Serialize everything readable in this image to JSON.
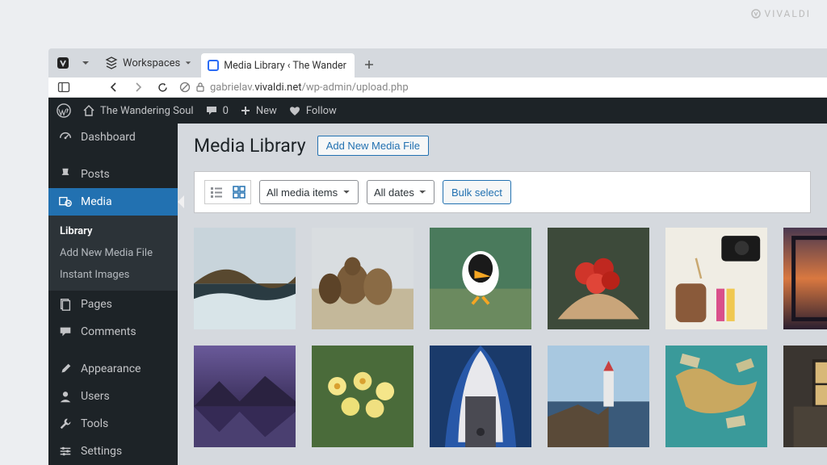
{
  "brand": "VIVALDI",
  "tab_strip": {
    "workspaces_label": "Workspaces",
    "tab_title": "Media Library ‹ The Wander"
  },
  "address_bar": {
    "url_prefix": "gabrielav.",
    "url_domain": "vivaldi.net",
    "url_path": "/wp-admin/upload.php"
  },
  "admin_bar": {
    "site_name": "The Wandering Soul",
    "comments_count": "0",
    "new_label": "New",
    "follow_label": "Follow"
  },
  "sidebar": {
    "items": [
      {
        "label": "Dashboard",
        "icon": "dashboard"
      },
      {
        "label": "Posts",
        "icon": "pin"
      },
      {
        "label": "Media",
        "icon": "media",
        "active": true
      },
      {
        "label": "Pages",
        "icon": "pages"
      },
      {
        "label": "Comments",
        "icon": "comments"
      },
      {
        "label": "Appearance",
        "icon": "brush"
      },
      {
        "label": "Users",
        "icon": "user"
      },
      {
        "label": "Tools",
        "icon": "wrench"
      },
      {
        "label": "Settings",
        "icon": "sliders"
      }
    ],
    "submenu": [
      {
        "label": "Library",
        "current": true
      },
      {
        "label": "Add New Media File"
      },
      {
        "label": "Instant Images"
      }
    ]
  },
  "page": {
    "title": "Media Library",
    "add_new_label": "Add New Media File",
    "filter_type": "All media items",
    "filter_date": "All dates",
    "bulk_label": "Bulk select"
  },
  "media": [
    {
      "name": "coastline"
    },
    {
      "name": "horses"
    },
    {
      "name": "puffin"
    },
    {
      "name": "tomatoes"
    },
    {
      "name": "camera-flatlay"
    },
    {
      "name": "sunset"
    },
    {
      "name": "mountain-lake-purple"
    },
    {
      "name": "daffodils"
    },
    {
      "name": "subway-blue"
    },
    {
      "name": "lighthouse"
    },
    {
      "name": "world-map-money"
    },
    {
      "name": "van-window"
    }
  ]
}
